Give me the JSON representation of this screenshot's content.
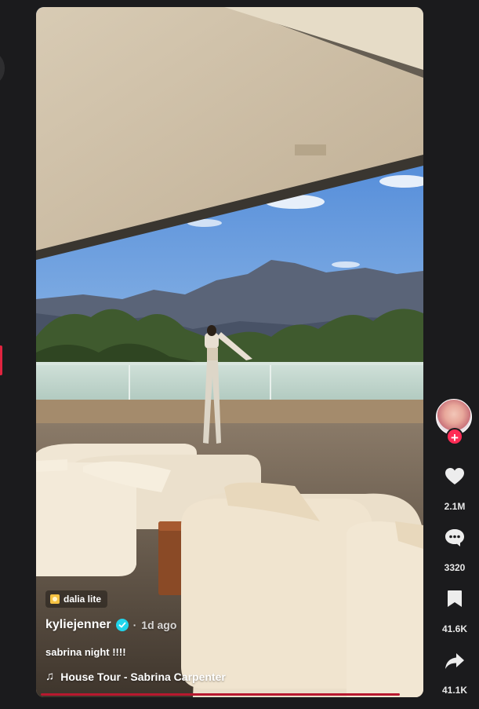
{
  "video": {
    "effect_label": "dalia lite",
    "author": "kyliejenner",
    "separator": "·",
    "posted": "1d ago",
    "caption": "sabrina night !!!!",
    "music": "House Tour - Sabrina Carpenter"
  },
  "actions": {
    "likes": "2.1M",
    "comments": "3320",
    "saves": "41.6K",
    "shares": "41.1K"
  },
  "colors": {
    "accent": "#fe2c55",
    "verified": "#20d5ec",
    "background": "#1b1b1d"
  },
  "icons": [
    "music-note-icon",
    "heart-icon",
    "comment-icon",
    "bookmark-icon",
    "share-icon",
    "plus-icon",
    "verified-badge-icon"
  ]
}
